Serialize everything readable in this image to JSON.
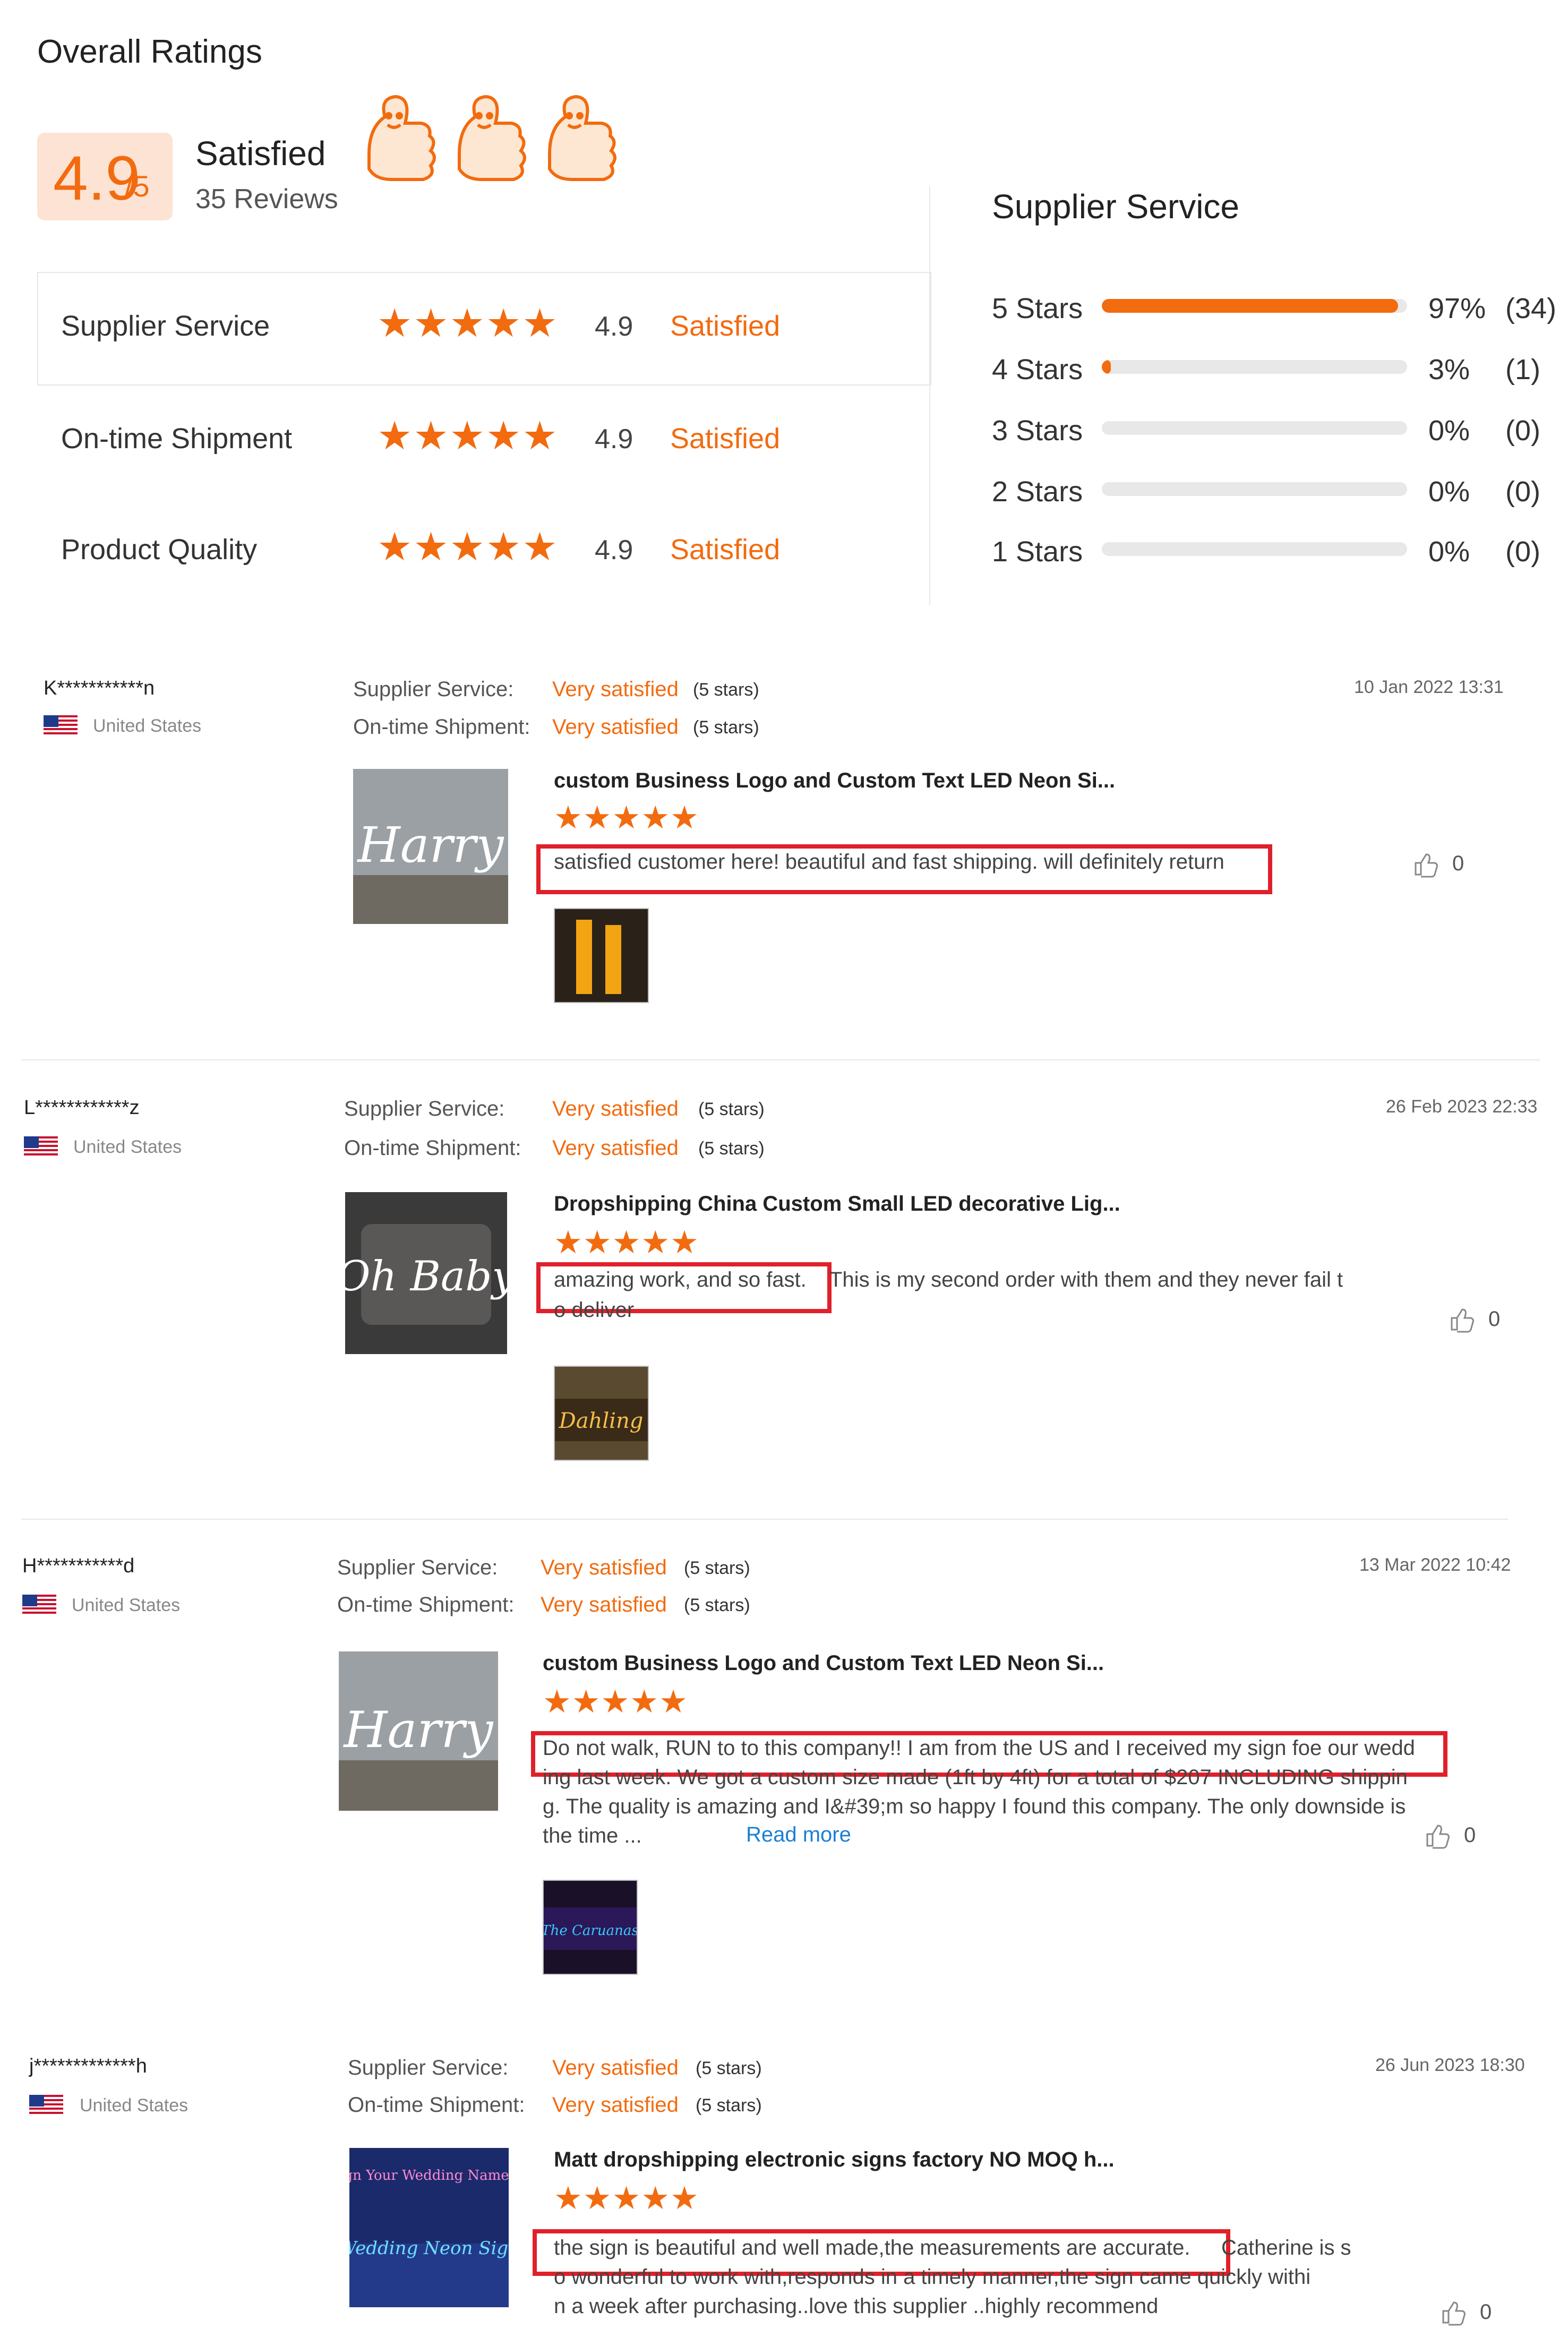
{
  "overall": {
    "title": "Overall Ratings",
    "score": "4.9",
    "score_suffix": "/5",
    "label": "Satisfied",
    "reviews": "35 Reviews"
  },
  "criteria": [
    {
      "label": "Supplier Service",
      "stars": "★★★★★",
      "score": "4.9",
      "status": "Satisfied"
    },
    {
      "label": "On-time Shipment",
      "stars": "★★★★★",
      "score": "4.9",
      "status": "Satisfied"
    },
    {
      "label": "Product Quality",
      "stars": "★★★★★",
      "score": "4.9",
      "status": "Satisfied"
    }
  ],
  "distribution": {
    "title": "Supplier Service",
    "rows": [
      {
        "label": "5  Stars",
        "pct": "97%",
        "count": "(34)",
        "fill": 0.97
      },
      {
        "label": "4  Stars",
        "pct": "3%",
        "count": "(1)",
        "fill": 0.03
      },
      {
        "label": "3  Stars",
        "pct": "0%",
        "count": "(0)",
        "fill": 0
      },
      {
        "label": "2  Stars",
        "pct": "0%",
        "count": "(0)",
        "fill": 0
      },
      {
        "label": "1  Stars",
        "pct": "0%",
        "count": "(0)",
        "fill": 0
      }
    ]
  },
  "reviews": [
    {
      "name": "K***********n",
      "country": "United States",
      "service_key": "Supplier Service:",
      "service_val": "Very satisfied",
      "service_stars": "(5 stars)",
      "ship_key": "On-time Shipment:",
      "ship_val": "Very satisfied",
      "ship_stars": "(5 stars)",
      "date": "10 Jan 2022 13:31",
      "product": "custom Business Logo and Custom Text LED Neon Si...",
      "stars": "★★★★★",
      "text": "satisfied customer here! beautiful and fast shipping. will definitely return",
      "likes": "0",
      "img_text": "Harry"
    },
    {
      "name": "L************z",
      "country": "United States",
      "service_key": "Supplier Service:",
      "service_val": "Very satisfied",
      "service_stars": "(5 stars)",
      "ship_key": "On-time Shipment:",
      "ship_val": "Very satisfied",
      "ship_stars": "(5 stars)",
      "date": "26 Feb 2023 22:33",
      "product": "Dropshipping China Custom Small LED decorative Lig...",
      "stars": "★★★★★",
      "text_hl": "amazing work, and so fast.",
      "text_rest": "This is my second order with them and they never fail t",
      "text_line2": "o deliver",
      "likes": "0",
      "img_text": "Oh Baby",
      "thumb_text": "Dahling"
    },
    {
      "name": "H***********d",
      "country": "United States",
      "service_key": "Supplier Service:",
      "service_val": "Very satisfied",
      "service_stars": "(5 stars)",
      "ship_key": "On-time Shipment:",
      "ship_val": "Very satisfied",
      "ship_stars": "(5 stars)",
      "date": "13 Mar 2022 10:42",
      "product": "custom Business Logo and Custom Text LED Neon Si...",
      "stars": "★★★★★",
      "text_hl": "Do not walk, RUN to to this company!! I am from the US and I received my sign foe our wedd",
      "text_line2": "ing last week. We got a custom size made (1ft by 4ft) for a total of $207 INCLUDING shippin",
      "text_line3": "g. The quality is amazing and I&#39;m so happy I found this company. The only downside is",
      "text_line4": "the time ...",
      "read_more": "Read more",
      "likes": "0",
      "img_text": "Harry",
      "thumb_text": "The Caruanas"
    },
    {
      "name": "j*************h",
      "country": "United States",
      "service_key": "Supplier Service:",
      "service_val": "Very satisfied",
      "service_stars": "(5 stars)",
      "ship_key": "On-time Shipment:",
      "ship_val": "Very satisfied",
      "ship_stars": "(5 stars)",
      "date": "26 Jun 2023 18:30",
      "product": "Matt dropshipping electronic signs factory NO MOQ h...",
      "stars": "★★★★★",
      "text_hl": "the sign is beautiful and well made,the measurements are accurate.",
      "text_rest": "Catherine is s",
      "text_line2": "o wonderful to work with,responds in a timely manner,the sign came quickly withi",
      "text_line3": "n a week after purchasing..love this supplier ..highly recommend",
      "likes": "0",
      "img_text": "Wedding Neon Sign",
      "img_caption": "Design Your Wedding Name Sign"
    }
  ]
}
